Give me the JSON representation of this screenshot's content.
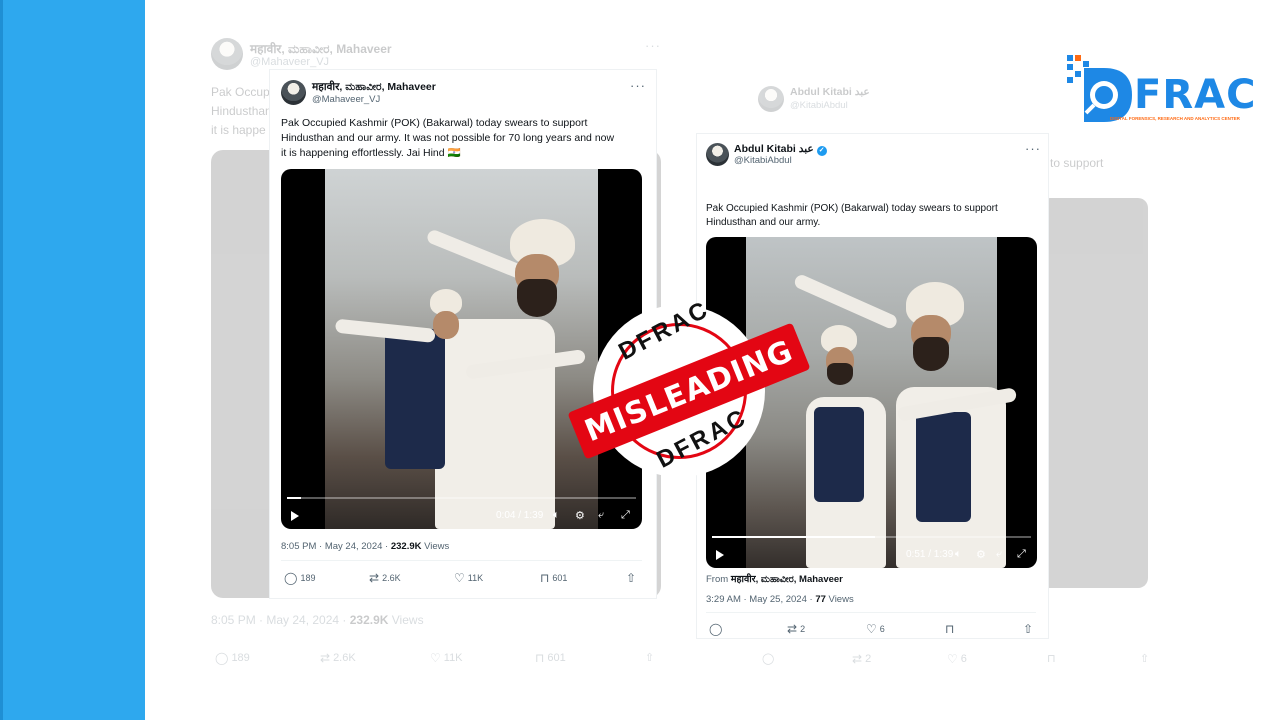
{
  "brand": {
    "name": "FRAC",
    "tagline": "DIGITAL FORENSICS, RESEARCH AND ANALYTICS CENTER",
    "color": "#1e88e5",
    "accent": "#ff6a13"
  },
  "stamp": {
    "top_text": "DFRAC",
    "bottom_text": "DFRAC",
    "label": "MISLEADING",
    "color": "#e30613"
  },
  "tweet1": {
    "name": "महावीर, ಮಹಾವೀರ, Mahaveer",
    "handle": "@Mahaveer_VJ",
    "more": "···",
    "text_lines": [
      "Pak Occupied Kashmir (POK) (Bakarwal) today swears to support",
      "Hindusthan and our army. It was not possible for 70 long years and now",
      "it is happening effortlessly. Jai Hind 🇮🇳"
    ],
    "video_time": "0:04 / 1:39",
    "timestamp": "8:05 PM · May 24, 2024 · ",
    "views": "232.9K",
    "views_label": " Views",
    "replies": "189",
    "retweets": "2.6K",
    "likes": "11K",
    "bookmarks": "601",
    "progress": 0.04
  },
  "tweet1_bg": {
    "name": "महावीर, ಮಹಾವೀರ, Mahaveer",
    "handle": "@Mahaveer_VJ",
    "text_lines": [
      "Pak Occupied",
      "Hindusthan",
      "it is happe"
    ],
    "timestamp": "8:05 PM · May 24, 2024 · ",
    "views": "232.9K",
    "views_label": " Views",
    "replies": "189",
    "retweets": "2.6K",
    "likes": "11K",
    "bookmarks": "601"
  },
  "tweet2": {
    "name": "Abdul Kitabi عبد",
    "handle": "@KitabiAbdul",
    "more": "···",
    "text_lines": [
      "Pak Occupied Kashmir (POK) (Bakarwal) today swears to support",
      "Hindusthan and our army."
    ],
    "video_time": "0:51 / 1:39",
    "from_label": "From ",
    "from_name": "महावीर, ಮಹಾವೀರ, Mahaveer",
    "timestamp": "3:29 AM · May 25, 2024 · ",
    "views": "77",
    "views_label": " Views",
    "retweets": "2",
    "likes": "6",
    "progress": 0.51
  },
  "tweet2_bg": {
    "name": "Abdul Kitabi عبد",
    "handle": "@KitabiAbdul",
    "text_fragment": "to support",
    "retweets": "2",
    "likes": "6"
  }
}
